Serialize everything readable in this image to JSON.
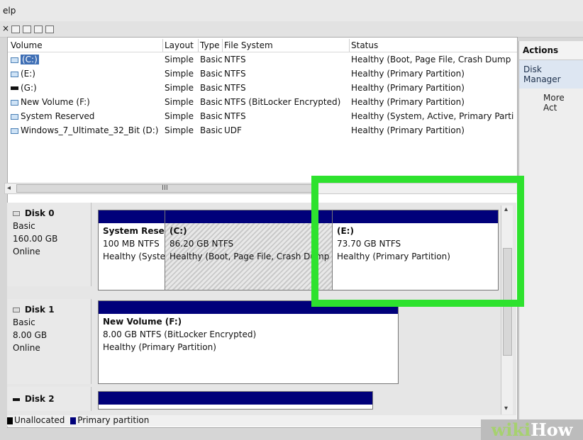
{
  "menu": {
    "help": "elp"
  },
  "toolbar": {
    "close": "×",
    "icons": [
      "properties-icon",
      "help-icon",
      "list-icon",
      "grid-icon"
    ]
  },
  "volume_list": {
    "columns": [
      "Volume",
      "Layout",
      "Type",
      "File System",
      "Status"
    ],
    "rows": [
      {
        "volume": "(C:)",
        "layout": "Simple",
        "type": "Basic",
        "fs": "NTFS",
        "status": "Healthy (Boot, Page File, Crash Dump"
      },
      {
        "volume": "(E:)",
        "layout": "Simple",
        "type": "Basic",
        "fs": "NTFS",
        "status": "Healthy (Primary Partition)"
      },
      {
        "volume": "(G:)",
        "layout": "Simple",
        "type": "Basic",
        "fs": "NTFS",
        "status": "Healthy (Primary Partition)"
      },
      {
        "volume": "New Volume (F:)",
        "layout": "Simple",
        "type": "Basic",
        "fs": "NTFS (BitLocker Encrypted)",
        "status": "Healthy (Primary Partition)"
      },
      {
        "volume": "System Reserved",
        "layout": "Simple",
        "type": "Basic",
        "fs": "NTFS",
        "status": "Healthy (System, Active, Primary Parti"
      },
      {
        "volume": "Windows_7_Ultimate_32_Bit (D:)",
        "layout": "Simple",
        "type": "Basic",
        "fs": "UDF",
        "status": "Healthy (Primary Partition)"
      }
    ],
    "scroll_grip": "III"
  },
  "disks": {
    "disk0": {
      "name": "Disk 0",
      "type": "Basic",
      "size": "160.00 GB",
      "state": "Online",
      "partitions": [
        {
          "title": "System Rese",
          "size": "100 MB NTFS",
          "status": "Healthy (Syste"
        },
        {
          "title": "(C:)",
          "size": "86.20 GB NTFS",
          "status": "Healthy (Boot, Page File, Crash Dump"
        },
        {
          "title": "(E:)",
          "size": "73.70 GB NTFS",
          "status": "Healthy (Primary Partition)"
        }
      ]
    },
    "disk1": {
      "name": "Disk 1",
      "type": "Basic",
      "size": "8.00 GB",
      "state": "Online",
      "partitions": [
        {
          "title": "New Volume  (F:)",
          "size": "8.00 GB NTFS (BitLocker Encrypted)",
          "status": "Healthy (Primary Partition)"
        }
      ]
    },
    "disk2": {
      "name": "Disk 2"
    }
  },
  "legend": {
    "unallocated": "Unallocated",
    "primary": "Primary partition",
    "colors": {
      "unallocated": "#000000",
      "primary": "#00007a"
    }
  },
  "actions": {
    "header": "Actions",
    "item1": "Disk Manager",
    "item2": "More Act"
  },
  "watermark": {
    "part1": "wiki",
    "part2": "How"
  },
  "colors": {
    "highlight": "#2ee22e",
    "partition_bar": "#00007a",
    "selection": "#3f6fb5"
  }
}
